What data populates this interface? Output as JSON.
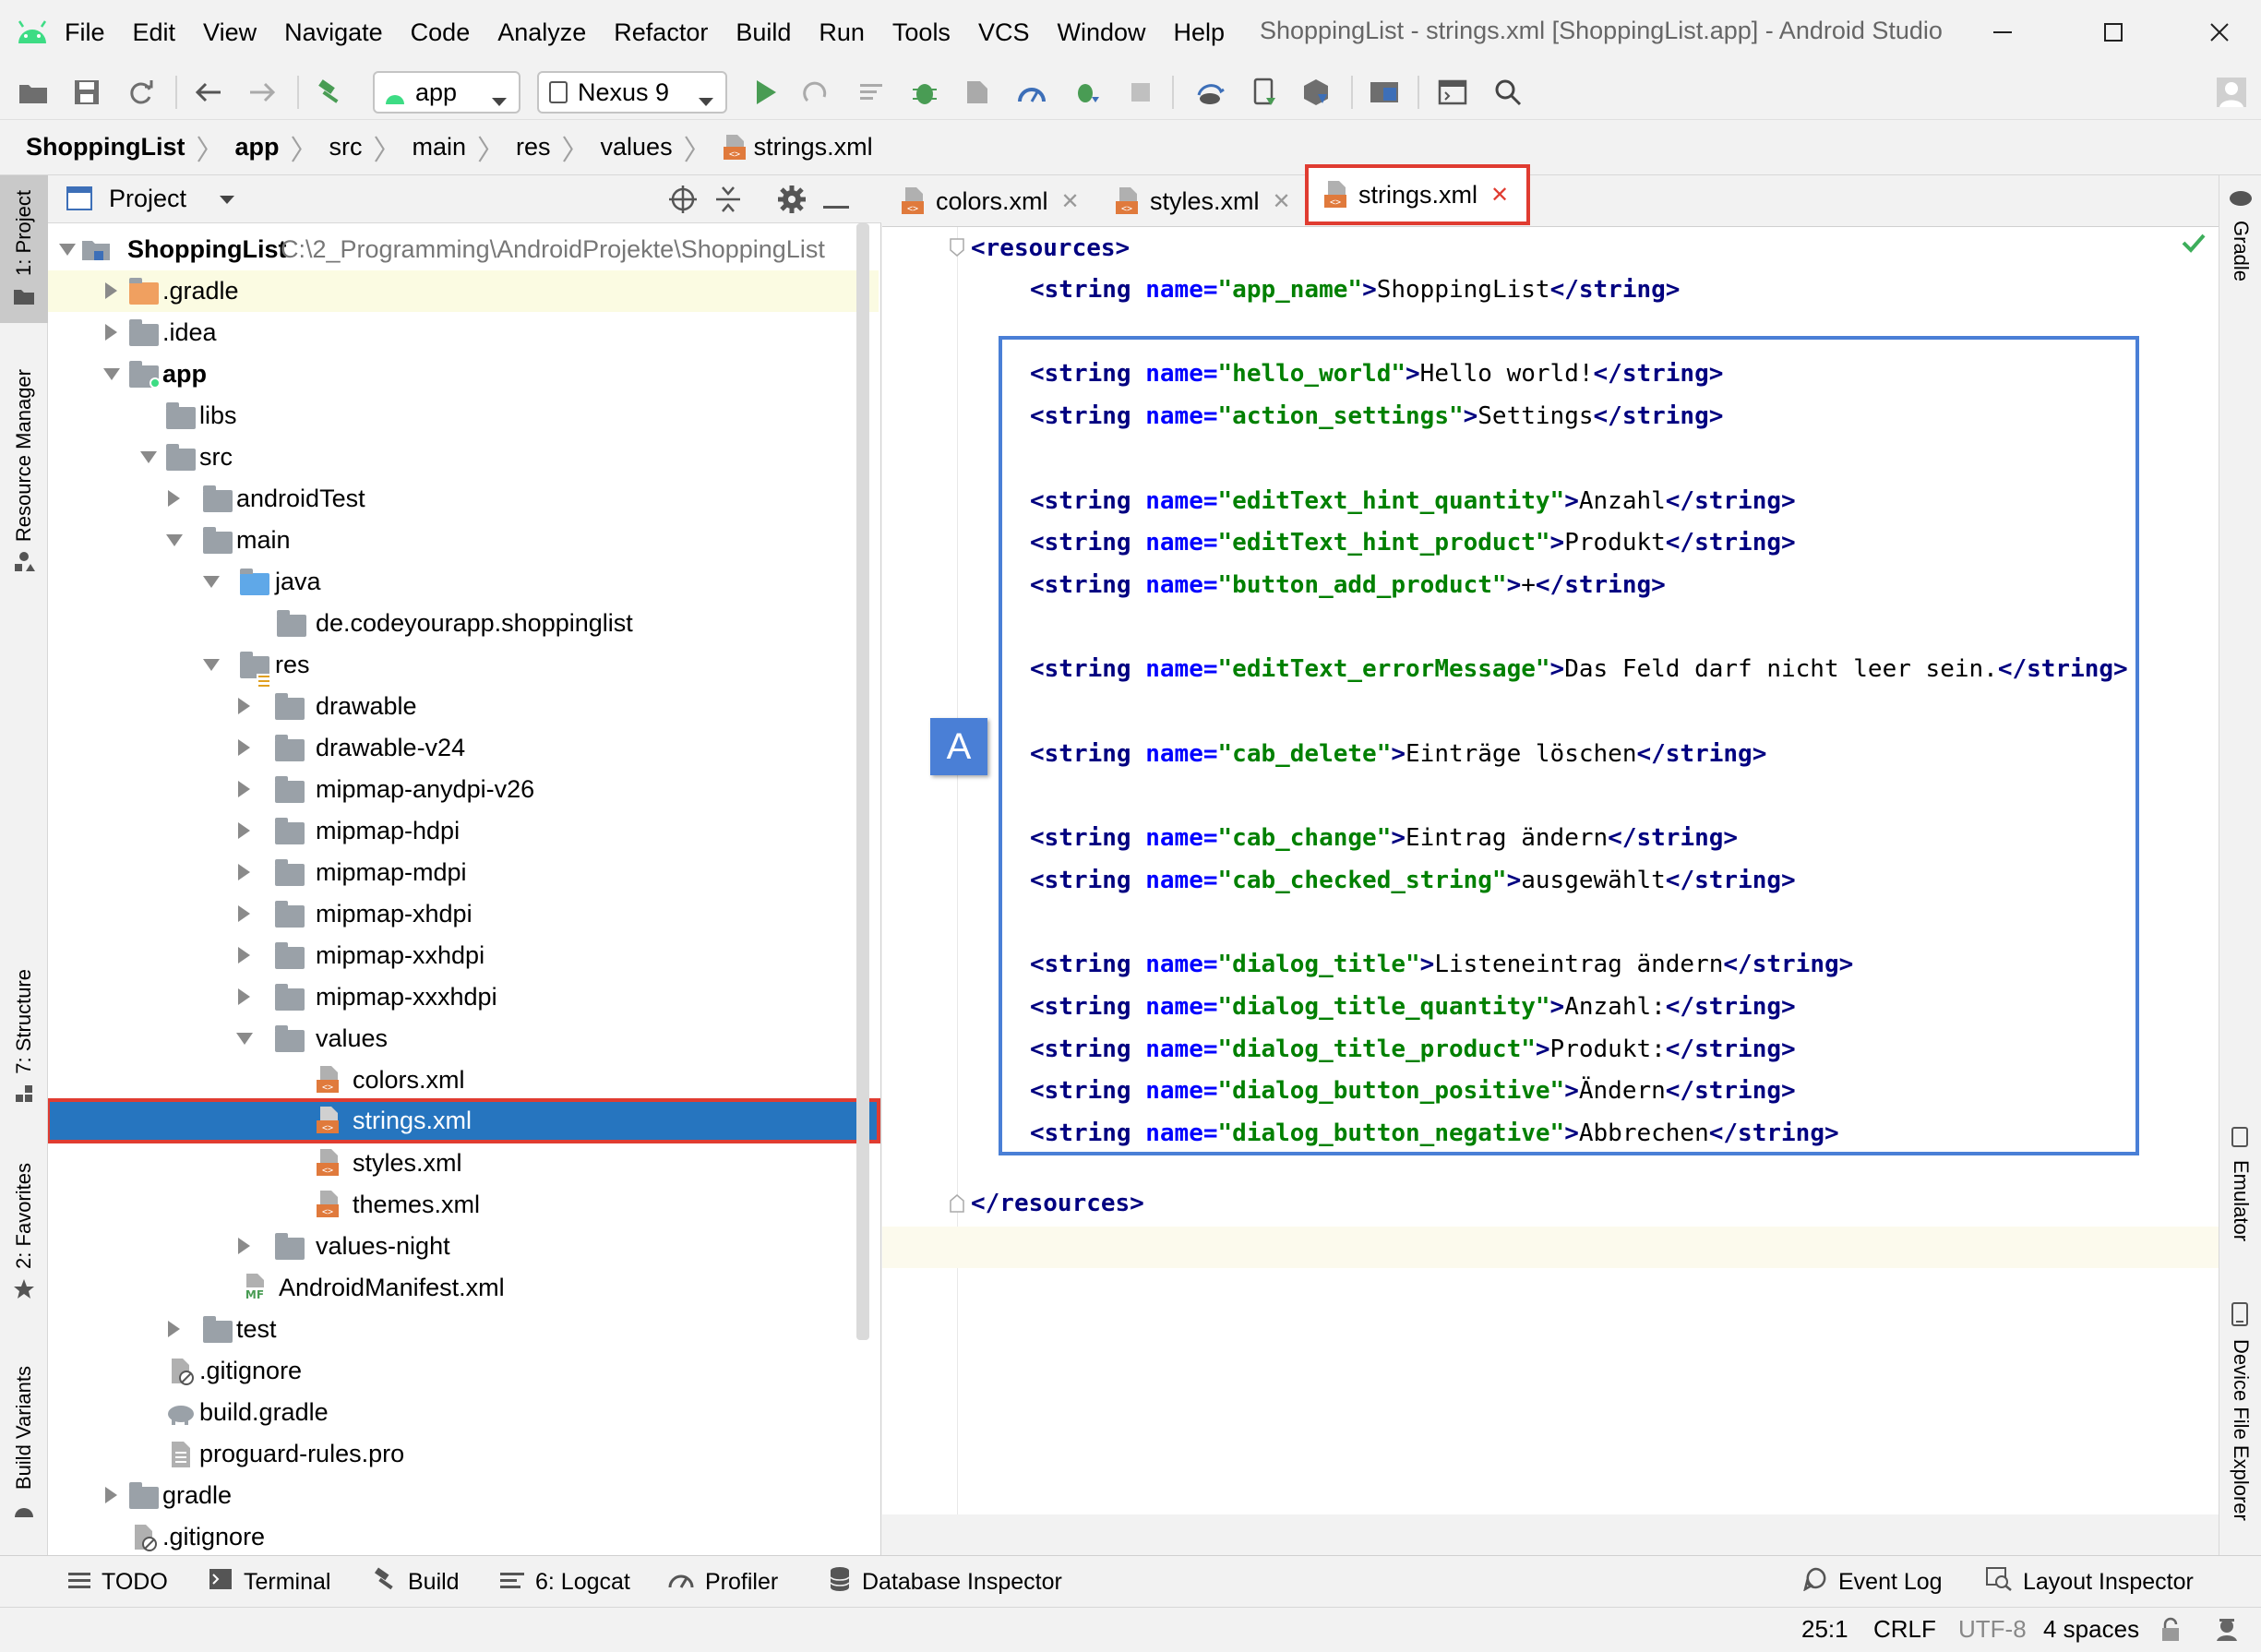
{
  "menubar": {
    "items": [
      "File",
      "Edit",
      "View",
      "Navigate",
      "Code",
      "Analyze",
      "Refactor",
      "Build",
      "Run",
      "Tools",
      "VCS",
      "Window",
      "Help"
    ],
    "window_title": "ShoppingList - strings.xml [ShoppingList.app] - Android Studio"
  },
  "toolbar": {
    "run_config": "app",
    "device": "Nexus 9"
  },
  "breadcrumb": [
    "ShoppingList",
    "app",
    "src",
    "main",
    "res",
    "values",
    "strings.xml"
  ],
  "left_stripe": {
    "project": "1: Project",
    "resource_manager": "Resource Manager",
    "structure": "7: Structure",
    "favorites": "2: Favorites",
    "build_variants": "Build Variants"
  },
  "right_stripe": {
    "gradle": "Gradle",
    "emulator": "Emulator",
    "device_file_explorer": "Device File Explorer"
  },
  "project_panel": {
    "title": "Project",
    "root_name": "ShoppingList",
    "root_path": "C:\\2_Programming\\AndroidProjekte\\ShoppingList",
    "tree": [
      {
        "label": ".gradle"
      },
      {
        "label": ".idea"
      },
      {
        "label": "app"
      },
      {
        "label": "libs"
      },
      {
        "label": "src"
      },
      {
        "label": "androidTest"
      },
      {
        "label": "main"
      },
      {
        "label": "java"
      },
      {
        "label": "de.codeyourapp.shoppinglist"
      },
      {
        "label": "res"
      },
      {
        "label": "drawable"
      },
      {
        "label": "drawable-v24"
      },
      {
        "label": "mipmap-anydpi-v26"
      },
      {
        "label": "mipmap-hdpi"
      },
      {
        "label": "mipmap-mdpi"
      },
      {
        "label": "mipmap-xhdpi"
      },
      {
        "label": "mipmap-xxhdpi"
      },
      {
        "label": "mipmap-xxxhdpi"
      },
      {
        "label": "values"
      },
      {
        "label": "colors.xml"
      },
      {
        "label": "strings.xml"
      },
      {
        "label": "styles.xml"
      },
      {
        "label": "themes.xml"
      },
      {
        "label": "values-night"
      },
      {
        "label": "AndroidManifest.xml"
      },
      {
        "label": "test"
      },
      {
        "label": ".gitignore"
      },
      {
        "label": "build.gradle"
      },
      {
        "label": "proguard-rules.pro"
      },
      {
        "label": "gradle"
      },
      {
        "label": ".gitignore"
      }
    ]
  },
  "editor_tabs": [
    "colors.xml",
    "styles.xml",
    "strings.xml"
  ],
  "editor": {
    "open_tag": "<resources>",
    "close_tag": "</resources>",
    "strings": [
      {
        "name": "app_name",
        "value": "ShoppingList"
      },
      {
        "name": "hello_world",
        "value": "Hello world!"
      },
      {
        "name": "action_settings",
        "value": "Settings"
      },
      {
        "name": "editText_hint_quantity",
        "value": "Anzahl"
      },
      {
        "name": "editText_hint_product",
        "value": "Produkt"
      },
      {
        "name": "button_add_product",
        "value": "+"
      },
      {
        "name": "editText_errorMessage",
        "value": "Das Feld darf nicht leer sein."
      },
      {
        "name": "cab_delete",
        "value": "Einträge löschen"
      },
      {
        "name": "cab_change",
        "value": "Eintrag ändern"
      },
      {
        "name": "cab_checked_string",
        "value": "ausgewählt"
      },
      {
        "name": "dialog_title",
        "value": "Listeneintrag ändern"
      },
      {
        "name": "dialog_title_quantity",
        "value": "Anzahl:"
      },
      {
        "name": "dialog_title_product",
        "value": "Produkt:"
      },
      {
        "name": "dialog_button_positive",
        "value": "Ändern"
      },
      {
        "name": "dialog_button_negative",
        "value": "Abbrechen"
      }
    ],
    "annotation_label": "A"
  },
  "bottom_tabs": {
    "todo": "TODO",
    "terminal": "Terminal",
    "build": "Build",
    "logcat": "6: Logcat",
    "profiler": "Profiler",
    "database_inspector": "Database Inspector",
    "event_log": "Event Log",
    "layout_inspector": "Layout Inspector"
  },
  "status": {
    "position": "25:1",
    "line_sep": "CRLF",
    "encoding": "UTF-8",
    "indent": "4 spaces"
  },
  "colors": {
    "selection": "#2675bf",
    "highlight_red": "#e03c31",
    "annotation_blue": "#4a7fd6"
  }
}
